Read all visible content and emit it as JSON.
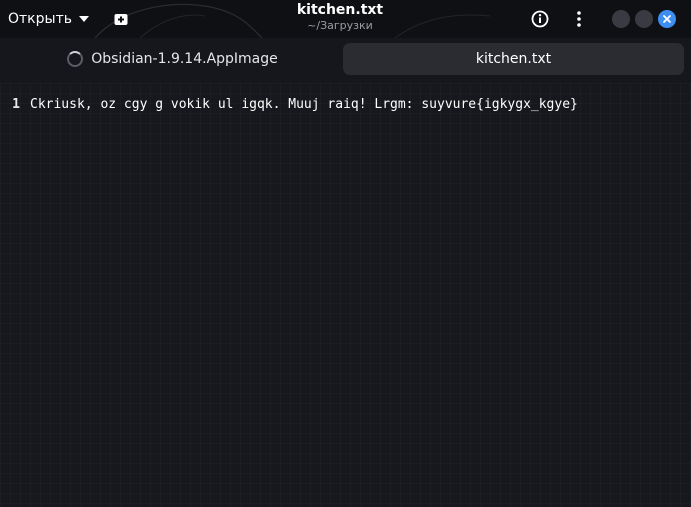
{
  "header": {
    "open_label": "Открыть",
    "title": "kitchen.txt",
    "subtitle": "~/Загрузки",
    "icons": {
      "new_tab": "new-tab-icon",
      "info": "info-icon",
      "menu": "kebab-menu-icon",
      "close": "close-icon"
    }
  },
  "tabs": [
    {
      "label": "Obsidian-1.9.14.AppImage",
      "loading": true,
      "active": false
    },
    {
      "label": "kitchen.txt",
      "loading": false,
      "active": true
    }
  ],
  "editor": {
    "lines": [
      {
        "number": "1",
        "text": "Ckriusk, oz cgy g vokik ul igqk. Muuj raiq! Lrgm: suyvure{igkygx_kgye}"
      }
    ]
  },
  "colors": {
    "accent": "#3d8ef0",
    "header_bg": "#0f1014",
    "editor_bg": "#17181e",
    "active_tab_bg": "#2b2c32"
  }
}
